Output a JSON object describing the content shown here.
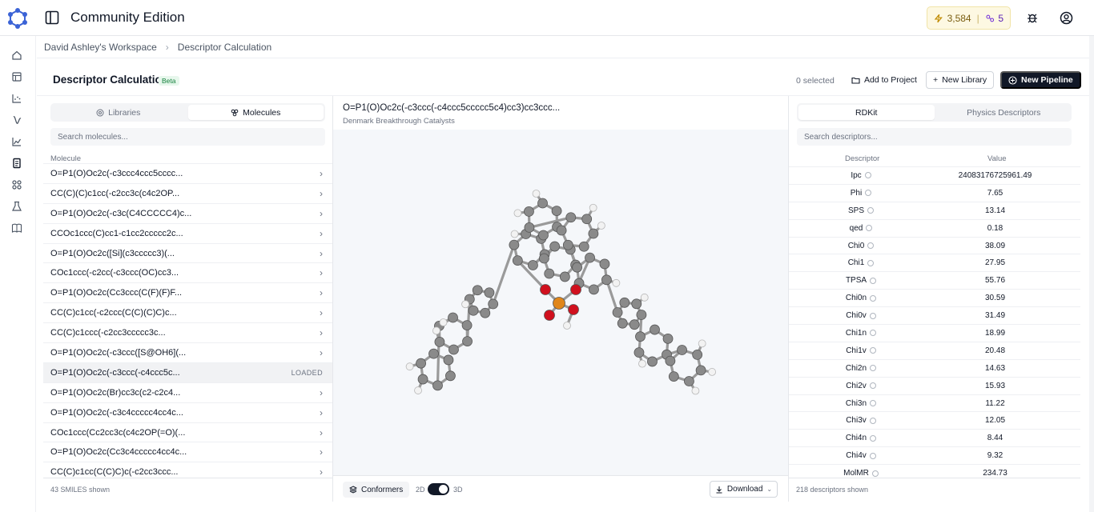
{
  "app": {
    "title": "Community Edition",
    "credits": "3,584",
    "credits_sep": "|",
    "secondary_count": "5"
  },
  "breadcrumb": {
    "workspace": "David Ashley's Workspace",
    "current": "Descriptor Calculation"
  },
  "page": {
    "title": "Descriptor Calculation",
    "badge": "Beta",
    "selected": "0 selected",
    "add_to_project": "Add to Project",
    "new_library": "New Library",
    "new_pipeline": "New Pipeline"
  },
  "left": {
    "tabs": [
      "Libraries",
      "Molecules"
    ],
    "active_tab": "Molecules",
    "search_placeholder": "Search molecules...",
    "column": "Molecule",
    "molecules": [
      {
        "smiles": "O=P1(O)Oc2c(-c3ccc4ccc5cccc...",
        "status": ""
      },
      {
        "smiles": "CC(C)(C)c1cc(-c2cc3c(c4c2OP...",
        "status": ""
      },
      {
        "smiles": "O=P1(O)Oc2c(-c3c(C4CCCCC4)c...",
        "status": ""
      },
      {
        "smiles": "CCOc1ccc(C)cc1-c1cc2ccccc2c...",
        "status": ""
      },
      {
        "smiles": "O=P1(O)Oc2c([Si](c3ccccc3)(...",
        "status": ""
      },
      {
        "smiles": "COc1ccc(-c2cc(-c3ccc(OC)cc3...",
        "status": ""
      },
      {
        "smiles": "O=P1(O)Oc2c(Cc3ccc(C(F)(F)F...",
        "status": ""
      },
      {
        "smiles": "CC(C)c1cc(-c2ccc(C(C)(C)C)c...",
        "status": ""
      },
      {
        "smiles": "CC(C)c1ccc(-c2cc3ccccc3c...",
        "status": ""
      },
      {
        "smiles": "O=P1(O)Oc2c(-c3ccc([S@OH6](...",
        "status": ""
      },
      {
        "smiles": "O=P1(O)Oc2c(-c3ccc(-c4ccc5c...",
        "status": "LOADED"
      },
      {
        "smiles": "O=P1(O)Oc2c(Br)cc3c(c2-c2c4...",
        "status": ""
      },
      {
        "smiles": "O=P1(O)Oc2c(-c3c4ccccc4cc4c...",
        "status": ""
      },
      {
        "smiles": "COc1ccc(Cc2cc3c(c4c2OP(=O)(...",
        "status": ""
      },
      {
        "smiles": "O=P1(O)Oc2c(Cc3c4ccccc4cc4c...",
        "status": ""
      },
      {
        "smiles": "CC(C)c1cc(C(C)C)c(-c2cc3ccc...",
        "status": ""
      }
    ],
    "footer": "43 SMILES shown"
  },
  "center": {
    "molecule_title": "O=P1(O)Oc2c(-c3ccc(-c4ccc5ccccc5c4)cc3)cc3ccc...",
    "subtitle": "Denmark Breakthrough Catalysts",
    "conformers": "Conformers",
    "mode_2d": "2D",
    "mode_3d": "3D",
    "mode_active": "3D",
    "download": "Download"
  },
  "right": {
    "tabs": [
      "RDKit",
      "Physics Descriptors"
    ],
    "active_tab": "RDKit",
    "search_placeholder": "Search descriptors...",
    "col_descriptor": "Descriptor",
    "col_value": "Value",
    "descriptors": [
      {
        "name": "Ipc",
        "value": "24083176725961.49"
      },
      {
        "name": "Phi",
        "value": "7.65"
      },
      {
        "name": "SPS",
        "value": "13.14"
      },
      {
        "name": "qed",
        "value": "0.18"
      },
      {
        "name": "Chi0",
        "value": "38.09"
      },
      {
        "name": "Chi1",
        "value": "27.95"
      },
      {
        "name": "TPSA",
        "value": "55.76"
      },
      {
        "name": "Chi0n",
        "value": "30.59"
      },
      {
        "name": "Chi0v",
        "value": "31.49"
      },
      {
        "name": "Chi1n",
        "value": "18.99"
      },
      {
        "name": "Chi1v",
        "value": "20.48"
      },
      {
        "name": "Chi2n",
        "value": "14.63"
      },
      {
        "name": "Chi2v",
        "value": "15.93"
      },
      {
        "name": "Chi3n",
        "value": "11.22"
      },
      {
        "name": "Chi3v",
        "value": "12.05"
      },
      {
        "name": "Chi4n",
        "value": "8.44"
      },
      {
        "name": "Chi4v",
        "value": "9.32"
      },
      {
        "name": "MolMR",
        "value": "234.73"
      }
    ],
    "footer": "218 descriptors shown"
  },
  "colors": {
    "accent": "#111827",
    "logo": "#3b63d6",
    "beta": "#15803d",
    "credits_bg": "#fdf8e2",
    "carbon": "#8a8a8a",
    "oxygen": "#d0101e",
    "phosphorus": "#e0861a",
    "hydrogen": "#f2f2f2"
  },
  "icons": {
    "rail": [
      "home-icon",
      "table-icon",
      "chart-icon",
      "flask-wave-icon",
      "line-chart-icon",
      "document-icon",
      "molecule-icon",
      "beaker-icon",
      "book-icon"
    ]
  }
}
